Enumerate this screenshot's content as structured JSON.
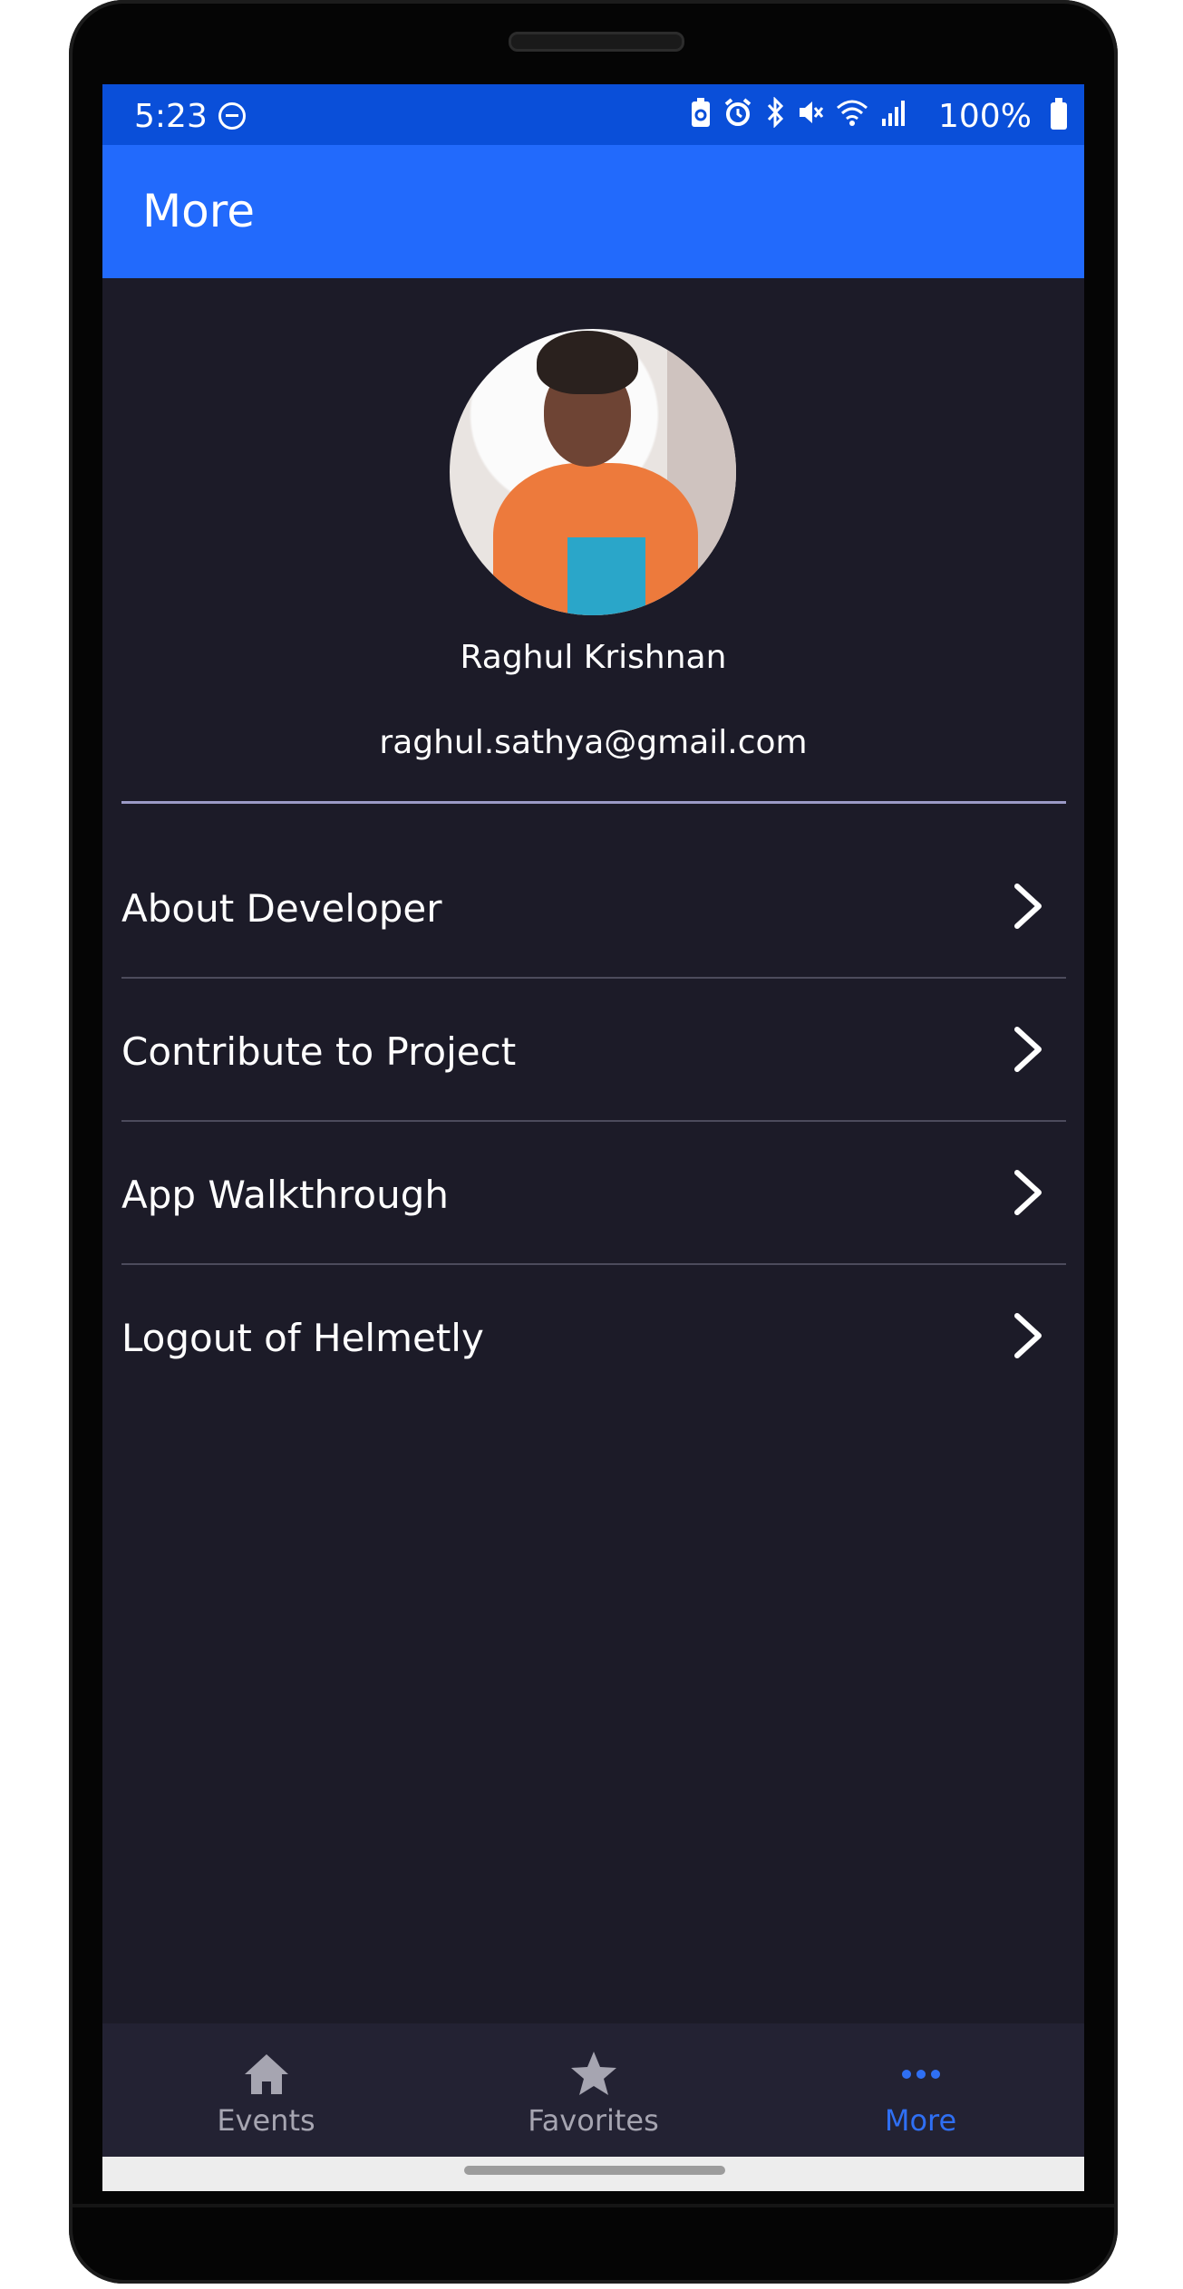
{
  "status_bar": {
    "time": "5:23",
    "battery_pct": "100%",
    "icons": [
      "dnd-icon",
      "battery-saver-icon",
      "alarm-icon",
      "bluetooth-icon",
      "mute-icon",
      "wifi-icon",
      "signal-icon",
      "battery-icon"
    ]
  },
  "app_bar": {
    "title": "More"
  },
  "profile": {
    "name": "Raghul Krishnan",
    "email": "raghul.sathya@gmail.com"
  },
  "menu": {
    "items": [
      {
        "label": "About Developer"
      },
      {
        "label": "Contribute to Project"
      },
      {
        "label": "App Walkthrough"
      },
      {
        "label": "Logout of Helmetly"
      }
    ]
  },
  "bottom_nav": {
    "tabs": [
      {
        "label": "Events",
        "icon": "home-icon",
        "active": false
      },
      {
        "label": "Favorites",
        "icon": "star-icon",
        "active": false
      },
      {
        "label": "More",
        "icon": "more-dots-icon",
        "active": true
      }
    ]
  },
  "colors": {
    "status_bar": "#0a4fd9",
    "app_bar": "#226afc",
    "background": "#1c1b28",
    "bottom_nav": "#232233",
    "active_tab": "#2f6ff3",
    "inactive_tab": "#a6a5b1"
  }
}
